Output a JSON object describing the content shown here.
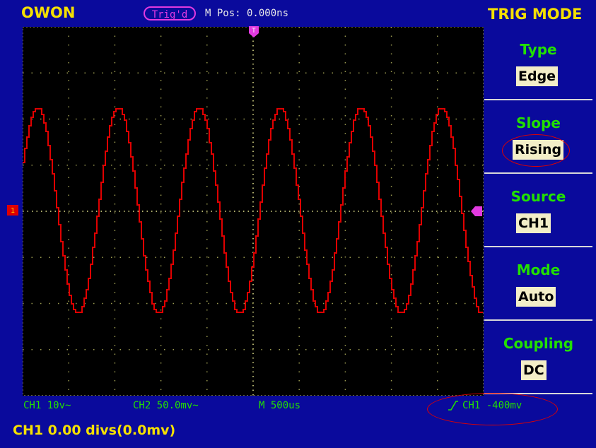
{
  "header": {
    "brand": "OWON",
    "trigger_status": "Trig'd",
    "mpos": "M Pos: 0.000ns",
    "menu_title": "TRIG MODE"
  },
  "menu": {
    "items": [
      {
        "label": "Type",
        "value": "Edge"
      },
      {
        "label": "Slope",
        "value": "Rising"
      },
      {
        "label": "Source",
        "value": "CH1"
      },
      {
        "label": "Mode",
        "value": "Auto"
      },
      {
        "label": "Coupling",
        "value": "DC"
      }
    ]
  },
  "status": {
    "ch1": "CH1 10v~",
    "ch2": "CH2 50.0mv~",
    "timebase": "M 500us",
    "trigger": "CH1 -400mv"
  },
  "message": "CH1 0.00 divs(0.0mv)",
  "markers": {
    "channel": "1",
    "trigger_pos": "T"
  },
  "colors": {
    "background": "#0a0a9c",
    "trace": "#e00000",
    "accent_yellow": "#f5e000",
    "label_green": "#22e000",
    "trigger_magenta": "#e23ae0"
  },
  "waveform": {
    "cycles_visible": 5.7,
    "highlighted_items": [
      "Slope",
      "trigger"
    ]
  }
}
